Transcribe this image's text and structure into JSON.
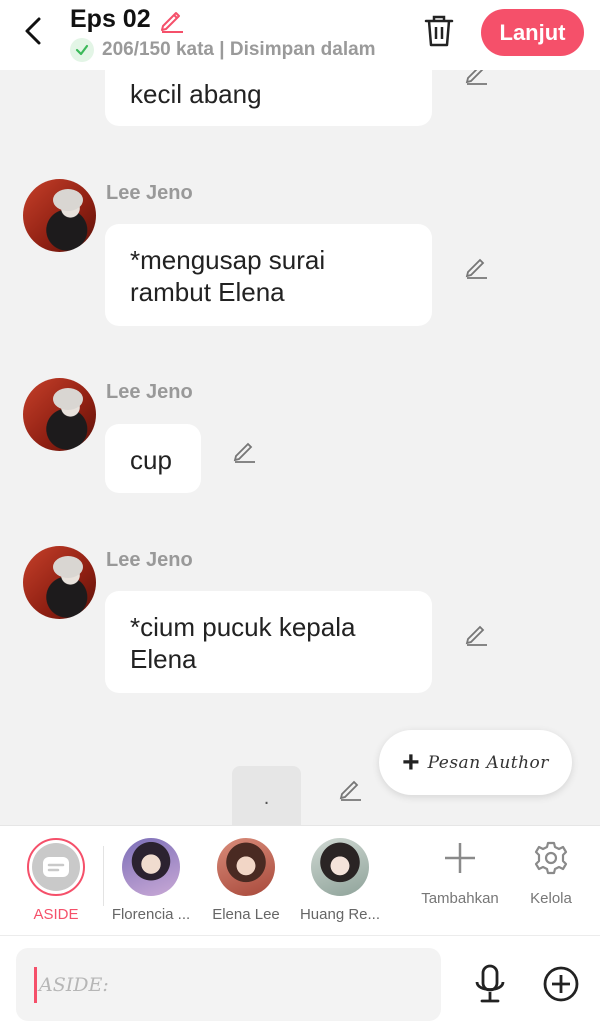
{
  "header": {
    "title": "Eps 02",
    "status": "206/150 kata | Disimpan dalam",
    "next_label": "Lanjut"
  },
  "chat": {
    "messages": [
      {
        "text_line1": "kecil abang",
        "text_line2": ""
      },
      {
        "sender": "Lee Jeno",
        "text_line1": "*mengusap surai",
        "text_line2": "rambut Elena"
      },
      {
        "sender": "Lee Jeno",
        "text_line1": "cup",
        "text_line2": ""
      },
      {
        "sender": "Lee Jeno",
        "text_line1": "*cium pucuk kepala",
        "text_line2": "Elena"
      },
      {
        "text_line1": ".",
        "text_line2": ""
      }
    ],
    "author_button_label": "Pesan Author"
  },
  "characters": {
    "items": [
      {
        "label": "ASIDE",
        "active": true
      },
      {
        "label": "Florencia ..."
      },
      {
        "label": "Elena Lee"
      },
      {
        "label": "Huang Re..."
      }
    ],
    "add_label": "Tambahkan",
    "manage_label": "Kelola"
  },
  "composer": {
    "placeholder": "ASIDE:"
  },
  "colors": {
    "accent": "#f5506a",
    "background": "#f2f2f2",
    "success": "#3cb95a"
  }
}
